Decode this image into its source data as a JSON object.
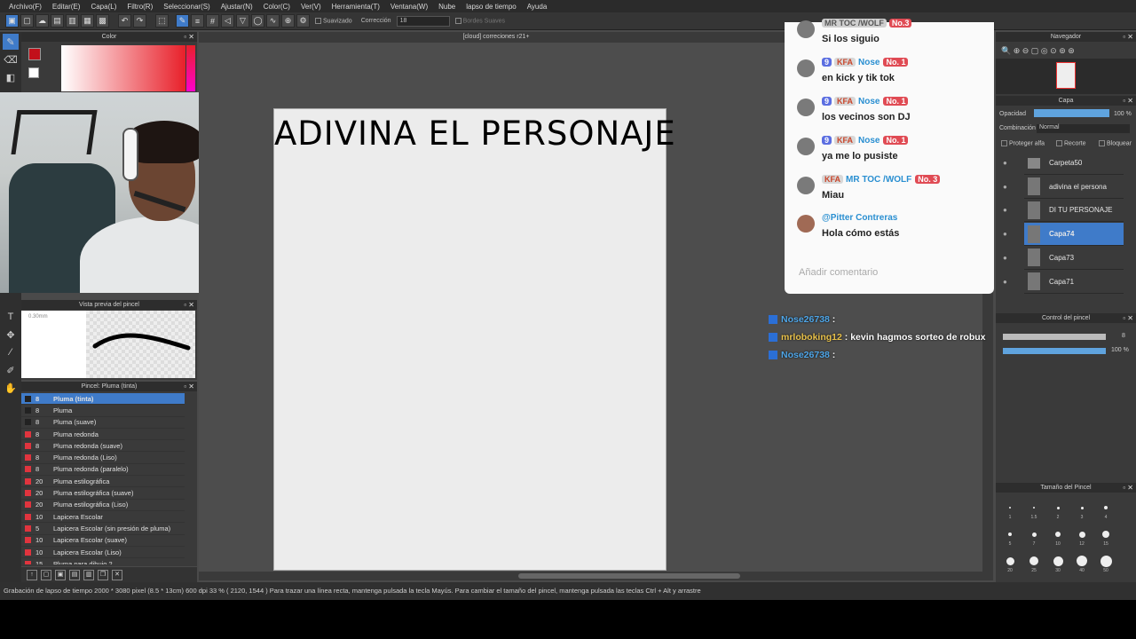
{
  "menu": [
    "Archivo(F)",
    "Editar(E)",
    "Capa(L)",
    "Filtro(R)",
    "Seleccionar(S)",
    "Ajustar(N)",
    "Color(C)",
    "Ver(V)",
    "Herramienta(T)",
    "Ventana(W)",
    "Nube",
    "lapso de tiempo",
    "Ayuda"
  ],
  "toolbar": {
    "suavizado": "Suavizado",
    "correccion": "Corrección",
    "correccion_val": "18",
    "bordes": "Bordes Suaves"
  },
  "panels": {
    "color": "Color",
    "brush_preview": "Vista previa del pincel",
    "brush_size_label": "0.30mm",
    "brush_list_title": "Pincel: Pluma (tinta)",
    "navigator": "Navegador",
    "layer": "Capa",
    "brush_control": "Control del pincel",
    "brush_size": "Tamaño del Pincel"
  },
  "brushes": [
    {
      "size": "8",
      "name": "Pluma (tinta)",
      "selected": true,
      "color": "#222222"
    },
    {
      "size": "8",
      "name": "Pluma",
      "color": "#222222"
    },
    {
      "size": "8",
      "name": "Pluma (suave)",
      "color": "#222222"
    },
    {
      "size": "8",
      "name": "Pluma redonda",
      "color": "#e0343e"
    },
    {
      "size": "8",
      "name": "Pluma redonda (suave)",
      "color": "#e0343e"
    },
    {
      "size": "8",
      "name": "Pluma redonda (Liso)",
      "color": "#e0343e"
    },
    {
      "size": "8",
      "name": "Pluma redonda (paralelo)",
      "color": "#e0343e"
    },
    {
      "size": "20",
      "name": "Pluma estilográfica",
      "color": "#e0343e"
    },
    {
      "size": "20",
      "name": "Pluma estilográfica (suave)",
      "color": "#e0343e"
    },
    {
      "size": "20",
      "name": "Pluma estilográfica (Liso)",
      "color": "#e0343e"
    },
    {
      "size": "10",
      "name": "Lapicera Escolar",
      "color": "#e0343e"
    },
    {
      "size": "5",
      "name": "Lapicera Escolar (sin presión de pluma)",
      "color": "#e0343e"
    },
    {
      "size": "10",
      "name": "Lapicera Escolar (suave)",
      "color": "#e0343e"
    },
    {
      "size": "10",
      "name": "Lapicera Escolar (Liso)",
      "color": "#e0343e"
    },
    {
      "size": "15",
      "name": "Pluma para dibujo 2",
      "color": "#e0343e"
    }
  ],
  "document": {
    "tab": "[cloud] correciones r21+",
    "canvas_title": "ADIVINA EL PERSONAJE"
  },
  "chat": {
    "messages": [
      {
        "meta": "MR TOC /WOLF",
        "badge_no": "No.3",
        "text": "Si los siguio"
      },
      {
        "level": "9",
        "kfa": "KFA",
        "name": "Nose",
        "badge_no": "No. 1",
        "text": "en kick y tik tok"
      },
      {
        "level": "9",
        "kfa": "KFA",
        "name": "Nose",
        "badge_no": "No. 1",
        "text": "los vecinos son DJ"
      },
      {
        "level": "9",
        "kfa": "KFA",
        "name": "Nose",
        "badge_no": "No. 1",
        "text": "ya me lo pusiste"
      },
      {
        "kfa": "KFA",
        "name": "MR TOC /WOLF",
        "badge_no": "No. 3",
        "text": "Miau"
      },
      {
        "name": "@Pitter Contreras",
        "text": "Hola cómo estás"
      }
    ],
    "input_placeholder": "Añadir comentario"
  },
  "overlay_chat": [
    {
      "user": "Nose26738",
      "text": ""
    },
    {
      "user": "mrloboking12",
      "text": "kevin hagmos sorteo de robux"
    },
    {
      "user": "Nose26738",
      "text": ""
    }
  ],
  "layer_panel": {
    "opacity_label": "Opacidad",
    "opacity": "100 %",
    "blend_label": "Combinación",
    "blend": "Normal",
    "protect": "Proteger alfa",
    "clip": "Recorte",
    "lock": "Bloquear",
    "layers": [
      "Carpeta50",
      "adivina el persona",
      "DI TU PERSONAJE",
      "Capa74",
      "Capa73",
      "Capa71"
    ],
    "selected": "Capa74"
  },
  "brush_control": {
    "size": "8",
    "opacity": "100 %"
  },
  "brush_sizes": [
    "1",
    "1.5",
    "2",
    "3",
    "4",
    "5",
    "7",
    "10",
    "12",
    "15",
    "20",
    "25",
    "30",
    "40",
    "50"
  ],
  "status": "Grabación de lapso de tiempo  2000 * 3080 pixel  (8.5 * 13cm)  600 dpi  33 %  ( 2120, 1544 )  Para trazar una línea recta, mantenga pulsada la tecla Mayús. Para cambiar el tamaño del pincel, mantenga pulsada las teclas Ctrl + Alt y arrastre",
  "colors": {
    "accent": "#3f7bc9",
    "fg_swatch": "#c2101a"
  }
}
